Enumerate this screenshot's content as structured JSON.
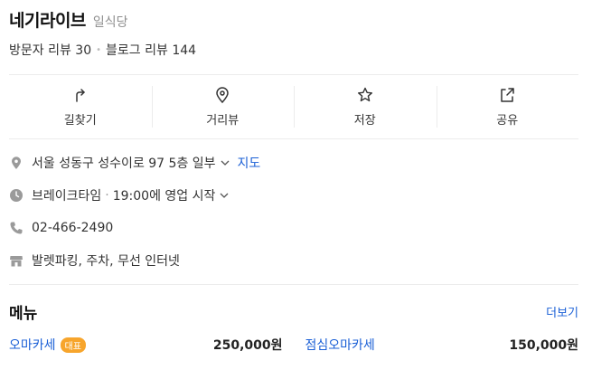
{
  "place": {
    "name": "네기라이브",
    "category": "일식당",
    "visitor_reviews": "방문자 리뷰 30",
    "blog_reviews": "블로그 리뷰 144"
  },
  "actions": [
    {
      "label": "길찾기",
      "icon": "directions-icon"
    },
    {
      "label": "거리뷰",
      "icon": "location-pin-icon"
    },
    {
      "label": "저장",
      "icon": "star-icon"
    },
    {
      "label": "공유",
      "icon": "share-icon"
    }
  ],
  "info": {
    "address": "서울 성동구 성수이로 97 5층 일부",
    "map_link": "지도",
    "hours_status": "브레이크타임",
    "hours_detail": "19:00에 영업 시작",
    "phone": "02-466-2490",
    "amenities": "발렛파킹, 주차, 무선 인터넷"
  },
  "menu": {
    "title": "메뉴",
    "more": "더보기",
    "items": [
      {
        "name": "오마카세",
        "badge": "대표",
        "price": "250,000원"
      },
      {
        "name": "점심오마카세",
        "badge": "",
        "price": "150,000원"
      }
    ]
  },
  "colors": {
    "link": "#1a5fd6",
    "badge": "#f7a52c",
    "icon_gray": "#9a9a9a"
  }
}
